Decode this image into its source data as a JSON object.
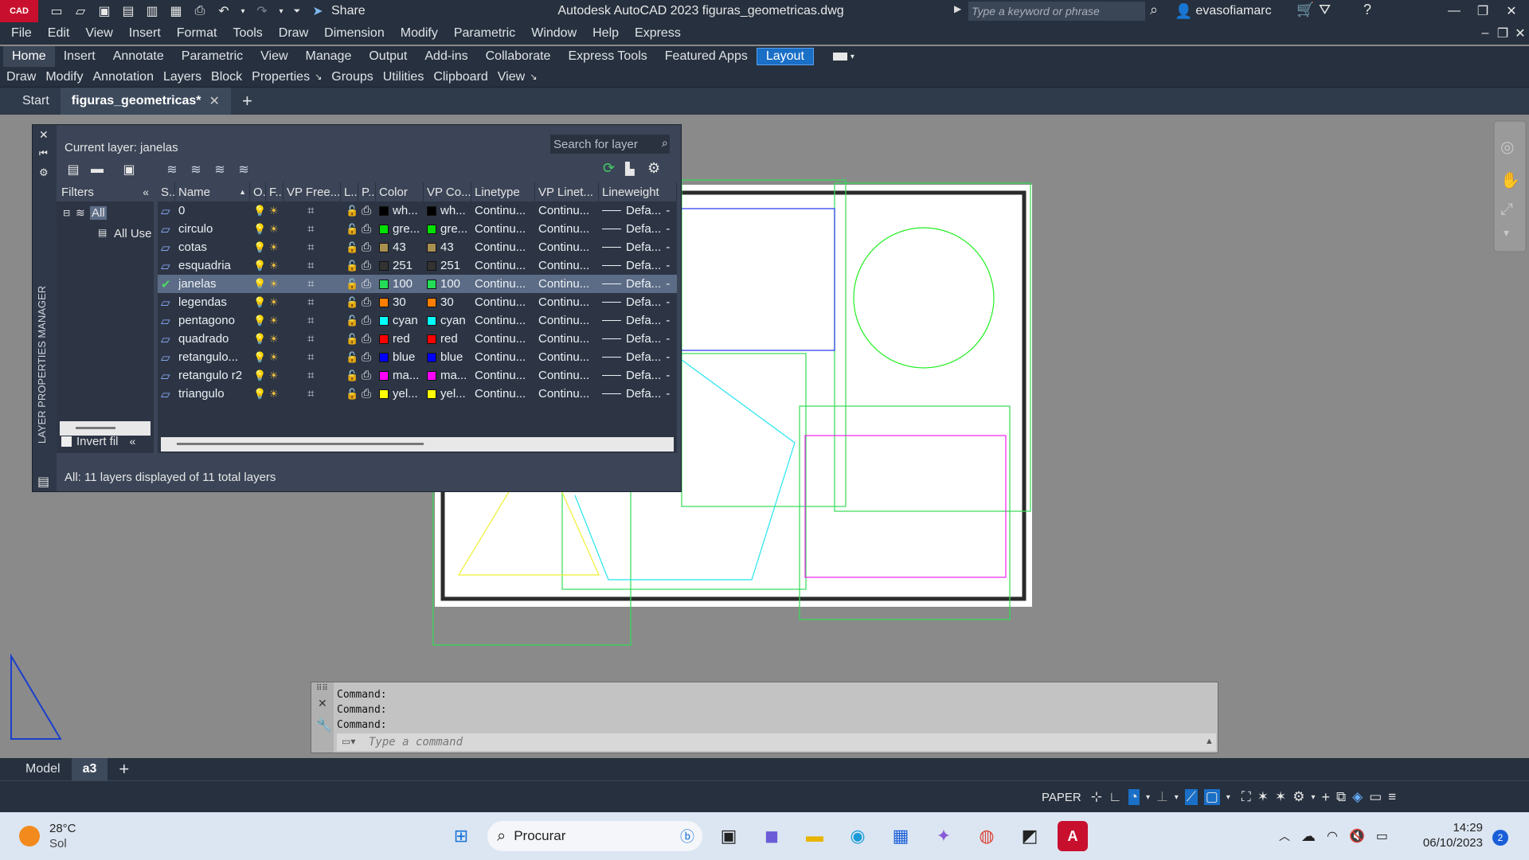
{
  "app": {
    "logo_text": "CAD",
    "title": "Autodesk AutoCAD 2023   figuras_geometricas.dwg",
    "share_label": "Share",
    "search_placeholder": "Type a keyword or phrase",
    "username": "evasofiamarc"
  },
  "menu": [
    "File",
    "Edit",
    "View",
    "Insert",
    "Format",
    "Tools",
    "Draw",
    "Dimension",
    "Modify",
    "Parametric",
    "Window",
    "Help",
    "Express"
  ],
  "ribbon_tabs": [
    "Home",
    "Insert",
    "Annotate",
    "Parametric",
    "View",
    "Manage",
    "Output",
    "Add-ins",
    "Collaborate",
    "Express Tools",
    "Featured Apps",
    "Layout"
  ],
  "panels": [
    "Draw",
    "Modify",
    "Annotation",
    "Layers",
    "Block",
    "Properties",
    "Groups",
    "Utilities",
    "Clipboard",
    "View"
  ],
  "doc_tabs": {
    "start": "Start",
    "current": "figuras_geometricas*"
  },
  "layer_manager": {
    "side_title": "LAYER PROPERTIES MANAGER",
    "current_layer": "Current layer: janelas",
    "search_placeholder": "Search for layer",
    "filters_label": "Filters",
    "filter_all": "All",
    "filter_all_used": "All Use",
    "invert_filter": "Invert fil",
    "status": "All: 11 layers displayed of 11 total layers",
    "columns": [
      "S...",
      "Name",
      "O...",
      "F...",
      "VP Free...",
      "L...",
      "P...",
      "Color",
      "VP Co...",
      "Linetype",
      "VP Linet...",
      "Lineweight"
    ],
    "layers": [
      {
        "name": "0",
        "color": "wh...",
        "vpcolor": "wh...",
        "hex": "#000000",
        "linetype": "Continu...",
        "vplinetype": "Continu...",
        "lineweight": "Defa..."
      },
      {
        "name": "circulo",
        "color": "gre...",
        "vpcolor": "gre...",
        "hex": "#00e000",
        "linetype": "Continu...",
        "vplinetype": "Continu...",
        "lineweight": "Defa..."
      },
      {
        "name": "cotas",
        "color": "43",
        "vpcolor": "43",
        "hex": "#a89050",
        "linetype": "Continu...",
        "vplinetype": "Continu...",
        "lineweight": "Defa..."
      },
      {
        "name": "esquadria",
        "color": "251",
        "vpcolor": "251",
        "hex": "#333333",
        "linetype": "Continu...",
        "vplinetype": "Continu...",
        "lineweight": "Defa..."
      },
      {
        "name": "janelas",
        "color": "100",
        "vpcolor": "100",
        "hex": "#22dd55",
        "linetype": "Continu...",
        "vplinetype": "Continu...",
        "lineweight": "Defa...",
        "selected": true
      },
      {
        "name": "legendas",
        "color": "30",
        "vpcolor": "30",
        "hex": "#ff7f00",
        "linetype": "Continu...",
        "vplinetype": "Continu...",
        "lineweight": "Defa..."
      },
      {
        "name": "pentagono",
        "color": "cyan",
        "vpcolor": "cyan",
        "hex": "#00ffff",
        "linetype": "Continu...",
        "vplinetype": "Continu...",
        "lineweight": "Defa..."
      },
      {
        "name": "quadrado",
        "color": "red",
        "vpcolor": "red",
        "hex": "#ff0000",
        "linetype": "Continu...",
        "vplinetype": "Continu...",
        "lineweight": "Defa..."
      },
      {
        "name": "retangulo...",
        "color": "blue",
        "vpcolor": "blue",
        "hex": "#0000ff",
        "linetype": "Continu...",
        "vplinetype": "Continu...",
        "lineweight": "Defa..."
      },
      {
        "name": "retangulo r2",
        "color": "ma...",
        "vpcolor": "ma...",
        "hex": "#ff00ff",
        "linetype": "Continu...",
        "vplinetype": "Continu...",
        "lineweight": "Defa..."
      },
      {
        "name": "triangulo",
        "color": "yel...",
        "vpcolor": "yel...",
        "hex": "#ffff00",
        "linetype": "Continu...",
        "vplinetype": "Continu...",
        "lineweight": "Defa..."
      }
    ]
  },
  "command": {
    "history": [
      "Command:",
      "Command:",
      "Command:"
    ],
    "placeholder": "Type a command"
  },
  "layout_tabs": {
    "model": "Model",
    "current": "a3"
  },
  "status": {
    "space": "PAPER"
  },
  "taskbar": {
    "weather_temp": "28°C",
    "weather_desc": "Sol",
    "search_label": "Procurar",
    "time": "14:29",
    "date": "06/10/2023",
    "notifications": "2"
  }
}
